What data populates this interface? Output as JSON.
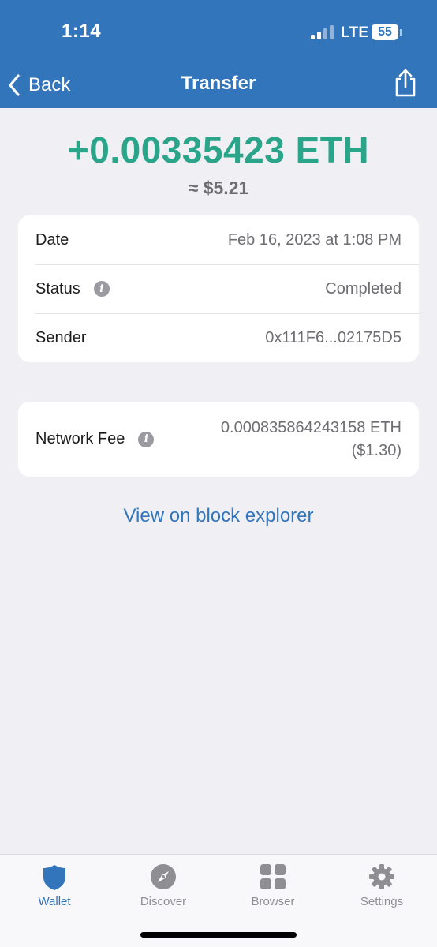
{
  "status_bar": {
    "time": "1:14",
    "network": "LTE",
    "battery": "55"
  },
  "nav": {
    "back_label": "Back",
    "title": "Transfer"
  },
  "transaction": {
    "amount": "+0.00335423 ETH",
    "fiat": "≈ $5.21",
    "details": [
      {
        "label": "Date",
        "value": "Feb 16, 2023 at 1:08 PM"
      },
      {
        "label": "Status",
        "value": "Completed"
      },
      {
        "label": "Sender",
        "value": "0x111F6...02175D5"
      }
    ],
    "fee": {
      "label": "Network Fee",
      "value_eth": "0.000835864243158 ETH",
      "value_fiat": "($1.30)"
    },
    "explorer_link": "View on block explorer"
  },
  "tabbar": {
    "tabs": [
      {
        "label": "Wallet",
        "icon": "shield-icon",
        "active": true
      },
      {
        "label": "Discover",
        "icon": "compass-icon",
        "active": false
      },
      {
        "label": "Browser",
        "icon": "grid-icon",
        "active": false
      },
      {
        "label": "Settings",
        "icon": "gear-icon",
        "active": false
      }
    ]
  },
  "colors": {
    "brand": "#3375bb",
    "positive": "#2aa58a",
    "background": "#f0f0f4"
  }
}
